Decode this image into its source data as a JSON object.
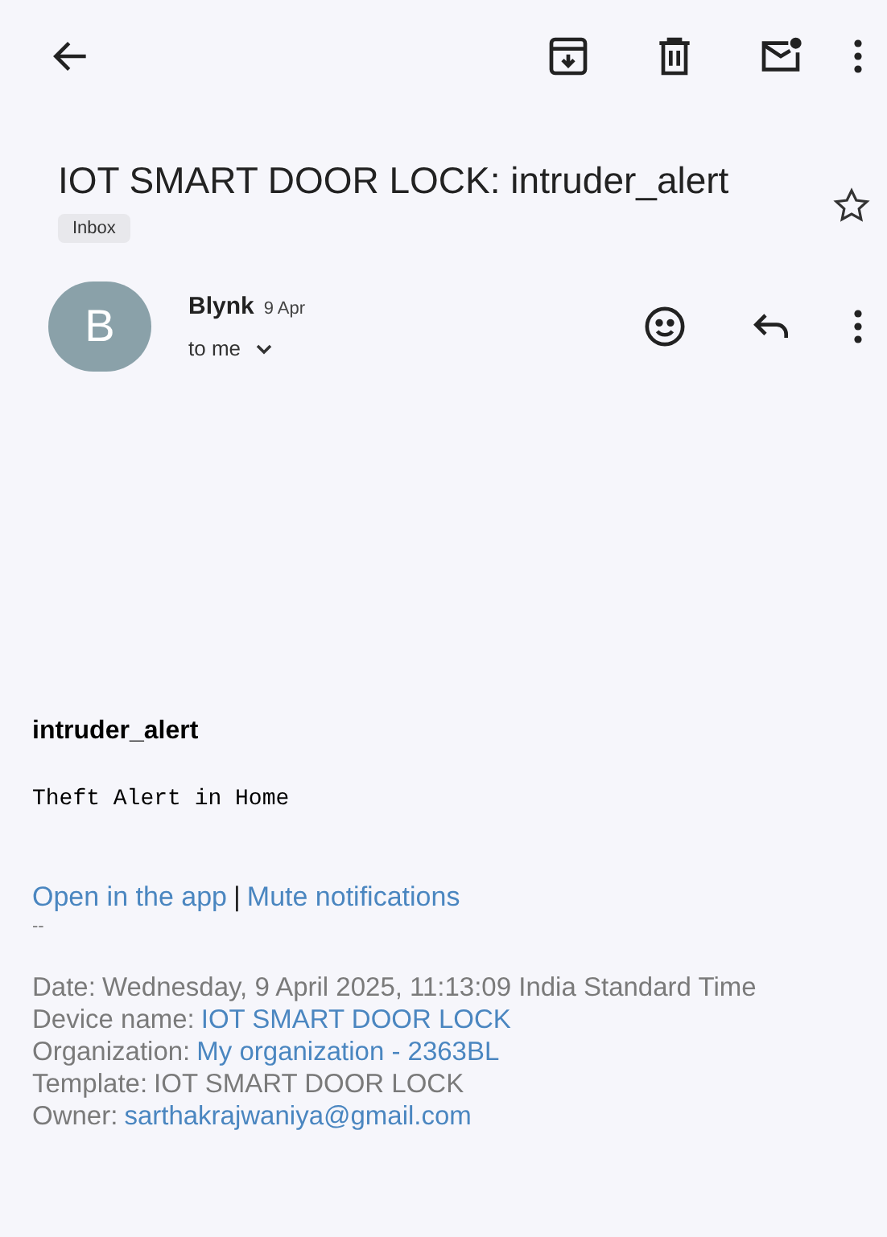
{
  "subject": "IOT SMART DOOR LOCK: intruder_alert",
  "starred": false,
  "label": "Inbox",
  "sender": {
    "initial": "B",
    "name": "Blynk",
    "date": "9 Apr",
    "recipient": "to me"
  },
  "body": {
    "heading": "intruder_alert",
    "message": "Theft Alert in Home",
    "links": [
      "Open in the app",
      "Mute notifications"
    ],
    "separator": "|",
    "signature_dash": "--",
    "details": [
      {
        "label": "Date:",
        "value": "Wednesday, 9 April 2025, 11:13:09 India Standard Time",
        "kind": "text"
      },
      {
        "label": "Device name:",
        "value": "IOT SMART DOOR LOCK",
        "kind": "link"
      },
      {
        "label": "Organization:",
        "value": "My organization - 2363BL",
        "kind": "link"
      },
      {
        "label": "Template:",
        "value": "IOT SMART DOOR LOCK",
        "kind": "text"
      },
      {
        "label": "Owner:",
        "value": "sarthakrajwaniya@gmail.com",
        "kind": "link"
      }
    ]
  }
}
